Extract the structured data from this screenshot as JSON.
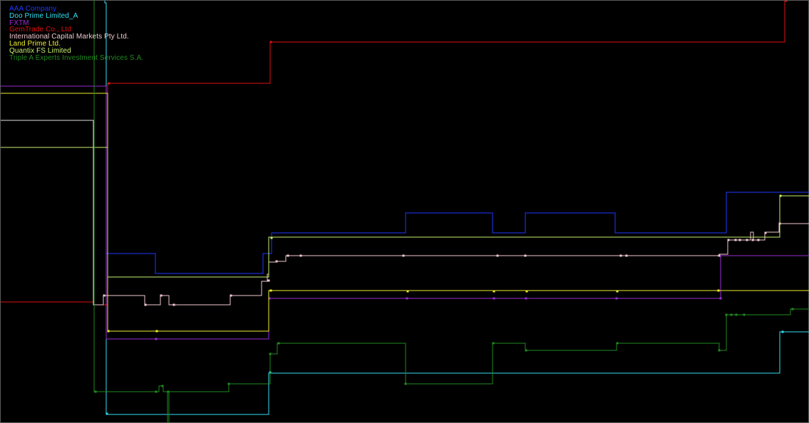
{
  "chart_data": {
    "type": "line",
    "title": "",
    "xlabel": "",
    "ylabel": "",
    "grid": false,
    "legend_position": "top-left",
    "background": "#000000",
    "series": [
      {
        "name": "AAA Company",
        "color": "#1f38ff",
        "steps": [
          [
            148,
            355
          ],
          [
            217,
            355
          ],
          [
            217,
            383
          ],
          [
            368,
            383
          ],
          [
            368,
            355
          ],
          [
            380,
            355
          ],
          [
            380,
            326
          ],
          [
            568,
            326
          ],
          [
            568,
            298
          ],
          [
            690,
            298
          ],
          [
            690,
            326
          ],
          [
            736,
            326
          ],
          [
            736,
            298
          ],
          [
            862,
            298
          ],
          [
            862,
            326
          ],
          [
            1018,
            326
          ],
          [
            1018,
            269
          ],
          [
            1135,
            269
          ]
        ],
        "markers": []
      },
      {
        "name": "Doo Prime Limited_A",
        "color": "#33e0f0",
        "steps": [
          [
            146,
            0
          ],
          [
            146,
            3
          ],
          [
            148,
            3
          ],
          [
            148,
            581
          ],
          [
            376,
            581
          ],
          [
            376,
            523
          ],
          [
            1093,
            523
          ],
          [
            1093,
            465
          ],
          [
            1135,
            465
          ]
        ],
        "markers": [
          [
            149,
            580
          ],
          [
            378,
            522
          ],
          [
            1097,
            465
          ]
        ]
      },
      {
        "name": "FXTM",
        "color": "#9a2bd6",
        "steps": [
          [
            0,
            120
          ],
          [
            148,
            120
          ],
          [
            148,
            475
          ],
          [
            376,
            475
          ],
          [
            376,
            418
          ],
          [
            1010,
            418
          ],
          [
            1010,
            358
          ],
          [
            1135,
            358
          ]
        ],
        "markers": [
          [
            218,
            475
          ],
          [
            377,
            418
          ],
          [
            570,
            418
          ],
          [
            692,
            418
          ],
          [
            737,
            418
          ],
          [
            864,
            418
          ],
          [
            1010,
            418
          ]
        ]
      },
      {
        "name": "GemTrade Co., Ltd",
        "color": "#e01010",
        "steps": [
          [
            0,
            423
          ],
          [
            130,
            423
          ],
          [
            130,
            427
          ],
          [
            150,
            427
          ],
          [
            150,
            116
          ],
          [
            378,
            116
          ],
          [
            378,
            58
          ],
          [
            1100,
            58
          ],
          [
            1100,
            0
          ]
        ],
        "markers": [
          [
            152,
            116
          ],
          [
            379,
            58
          ],
          [
            1102,
            0
          ]
        ]
      },
      {
        "name": "International Capital Markets Pty Ltd.",
        "color": "#f0c8d0",
        "steps": [
          [
            130,
            427
          ],
          [
            144,
            427
          ],
          [
            144,
            414
          ],
          [
            202,
            414
          ],
          [
            202,
            427
          ],
          [
            224,
            427
          ],
          [
            224,
            414
          ],
          [
            236,
            414
          ],
          [
            236,
            427
          ],
          [
            242,
            427
          ],
          [
            242,
            427
          ],
          [
            322,
            427
          ],
          [
            322,
            414
          ],
          [
            366,
            414
          ],
          [
            366,
            394
          ],
          [
            374,
            394
          ],
          [
            374,
            384
          ],
          [
            376,
            384
          ],
          [
            376,
            367
          ],
          [
            386,
            367
          ],
          [
            386,
            366
          ],
          [
            400,
            366
          ],
          [
            400,
            358
          ],
          [
            1008,
            358
          ],
          [
            1008,
            356
          ],
          [
            1020,
            356
          ],
          [
            1020,
            336
          ],
          [
            1052,
            336
          ],
          [
            1052,
            325
          ],
          [
            1056,
            325
          ],
          [
            1056,
            336
          ],
          [
            1072,
            336
          ],
          [
            1072,
            325
          ],
          [
            1092,
            325
          ],
          [
            1092,
            313
          ],
          [
            1135,
            313
          ]
        ],
        "markers": [
          [
            145,
            414
          ],
          [
            203,
            427
          ],
          [
            225,
            414
          ],
          [
            243,
            427
          ],
          [
            323,
            414
          ],
          [
            376,
            393
          ],
          [
            387,
            366
          ],
          [
            403,
            358
          ],
          [
            421,
            358
          ],
          [
            565,
            358
          ],
          [
            697,
            358
          ],
          [
            736,
            358
          ],
          [
            870,
            358
          ],
          [
            878,
            358
          ],
          [
            1008,
            358
          ],
          [
            1021,
            336
          ],
          [
            1031,
            336
          ],
          [
            1037,
            336
          ],
          [
            1047,
            336
          ],
          [
            1055,
            336
          ],
          [
            1063,
            336
          ],
          [
            1073,
            326
          ],
          [
            1093,
            313
          ]
        ]
      },
      {
        "name": "Land Prime Ltd.",
        "color": "#f0f030",
        "steps": [
          [
            0,
            130
          ],
          [
            150,
            130
          ],
          [
            150,
            464
          ],
          [
            376,
            464
          ],
          [
            376,
            407
          ],
          [
            1135,
            407
          ]
        ],
        "markers": [
          [
            151,
            464
          ],
          [
            219,
            464
          ],
          [
            379,
            407
          ],
          [
            571,
            408
          ],
          [
            692,
            408
          ],
          [
            738,
            408
          ],
          [
            865,
            408
          ],
          [
            1007,
            407
          ]
        ]
      },
      {
        "name": "Quantix FS Limited",
        "color": "#c8f070",
        "steps": [
          [
            0,
            206
          ],
          [
            150,
            206
          ],
          [
            150,
            388
          ],
          [
            376,
            388
          ],
          [
            376,
            332
          ],
          [
            1093,
            332
          ],
          [
            1093,
            274
          ],
          [
            1135,
            274
          ]
        ],
        "markers": [
          [
            380,
            333
          ],
          [
            1094,
            274
          ]
        ]
      },
      {
        "name": "Triple A Experts Investment Services S.A.",
        "color": "#208a20",
        "steps": [
          [
            131,
            0
          ],
          [
            131,
            549
          ],
          [
            222,
            549
          ],
          [
            222,
            541
          ],
          [
            228,
            541
          ],
          [
            228,
            549
          ],
          [
            234,
            549
          ],
          [
            234,
            594
          ],
          [
            236,
            594
          ],
          [
            236,
            549
          ],
          [
            320,
            549
          ],
          [
            320,
            538
          ],
          [
            378,
            538
          ],
          [
            378,
            496
          ],
          [
            388,
            496
          ],
          [
            388,
            481
          ],
          [
            568,
            481
          ],
          [
            568,
            538
          ],
          [
            690,
            538
          ],
          [
            690,
            481
          ],
          [
            736,
            481
          ],
          [
            736,
            491
          ],
          [
            864,
            491
          ],
          [
            864,
            481
          ],
          [
            1008,
            481
          ],
          [
            1008,
            491
          ],
          [
            1018,
            491
          ],
          [
            1018,
            441
          ],
          [
            1108,
            441
          ],
          [
            1108,
            433
          ],
          [
            1135,
            433
          ]
        ],
        "markers": [
          [
            133,
            549
          ],
          [
            218,
            549
          ],
          [
            227,
            541
          ],
          [
            235,
            549
          ],
          [
            320,
            538
          ],
          [
            378,
            496
          ],
          [
            390,
            481
          ],
          [
            568,
            538
          ],
          [
            691,
            481
          ],
          [
            737,
            491
          ],
          [
            865,
            481
          ],
          [
            1008,
            491
          ],
          [
            1018,
            441
          ],
          [
            1025,
            441
          ],
          [
            1032,
            441
          ],
          [
            1043,
            441
          ],
          [
            1111,
            433
          ]
        ]
      },
      {
        "name": "",
        "color": "#e0e0e0",
        "steps": [
          [
            0,
            168
          ],
          [
            130,
            168
          ],
          [
            130,
            427
          ],
          [
            131,
            427
          ]
        ],
        "markers": []
      }
    ]
  }
}
